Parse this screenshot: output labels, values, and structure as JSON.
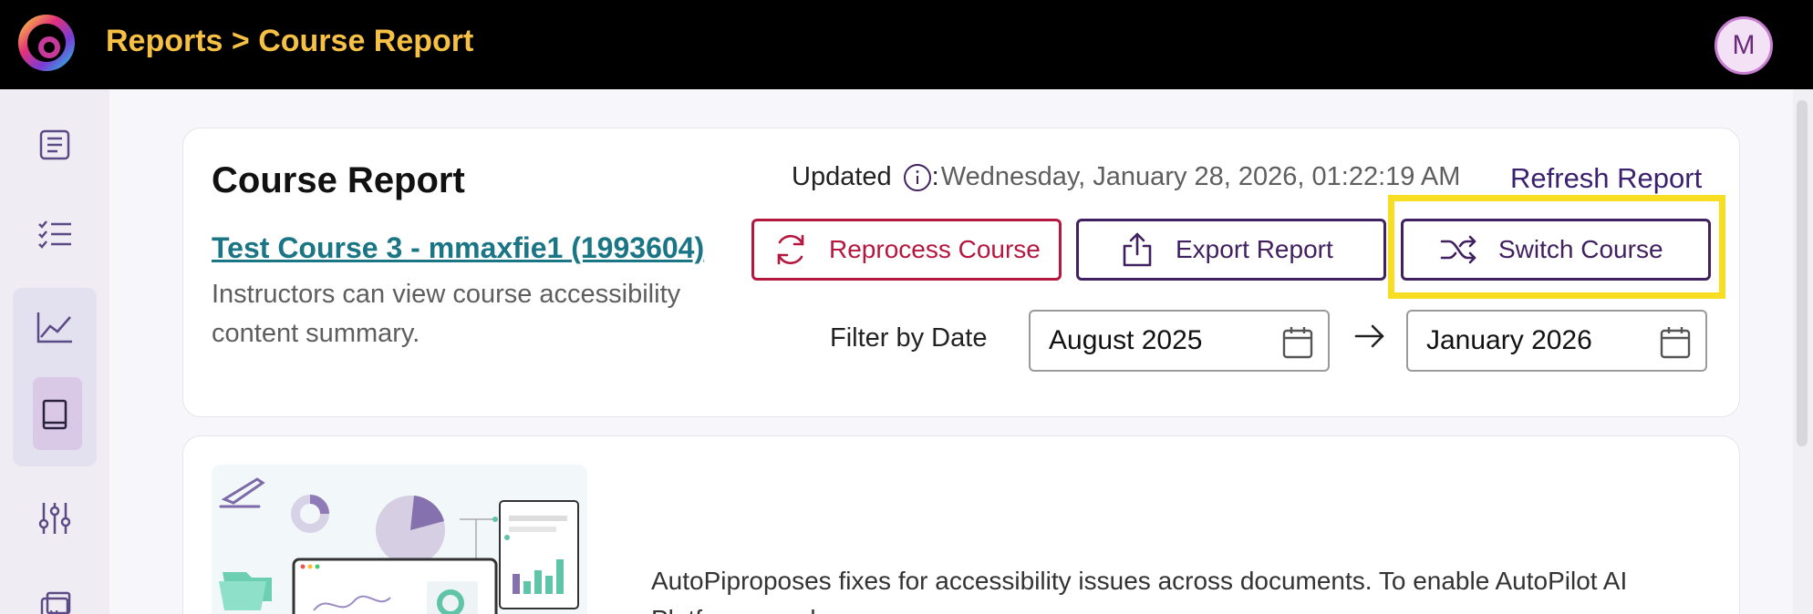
{
  "header": {
    "breadcrumb": "Reports > Course Report",
    "avatar_initial": "M",
    "logo_icon": "brand-logo-icon"
  },
  "sidebar": {
    "items": [
      {
        "icon": "document-icon"
      },
      {
        "icon": "checklist-icon"
      },
      {
        "icon": "chart-line-icon"
      },
      {
        "icon": "book-icon"
      },
      {
        "icon": "sliders-icon"
      },
      {
        "icon": "media-icon"
      }
    ]
  },
  "report": {
    "title": "Course Report",
    "course_link": "Test Course 3 - mmaxfie1 (1993604)",
    "description": "Instructors can view course accessibility content summary.",
    "updated_label": "Updated",
    "updated_date": "Wednesday, January 28, 2026, 01:22:19 AM",
    "refresh_label": "Refresh Report",
    "buttons": {
      "reprocess": "Reprocess Course",
      "export": "Export Report",
      "switch": "Switch Course"
    },
    "filter": {
      "label": "Filter by Date",
      "from": "August 2025",
      "to": "January 2026"
    }
  },
  "autopilot": {
    "line1": "AutoPiproposes fixes for accessibility issues across documents. To enable AutoPilot AI",
    "line2": "Platform, send"
  },
  "colors": {
    "accent": "#40205f",
    "danger": "#b5173f",
    "link": "#1a7585",
    "breadcrumb": "#f5c043",
    "highlight": "#f8de22"
  }
}
